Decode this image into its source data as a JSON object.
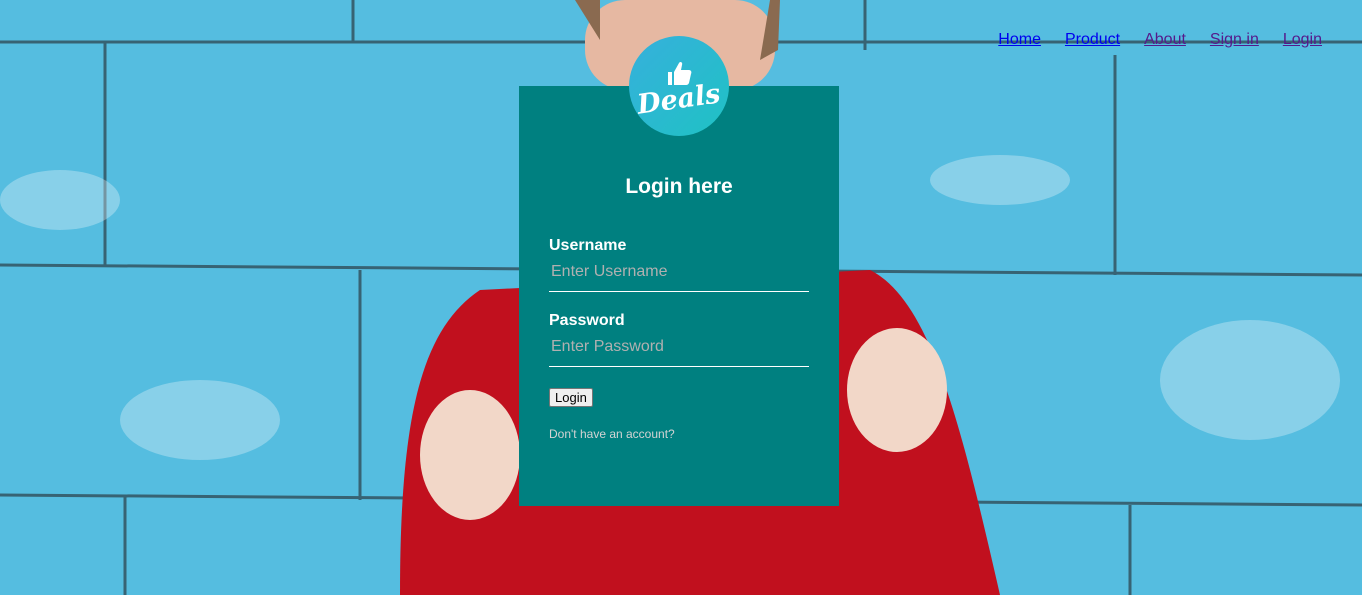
{
  "nav": {
    "items": [
      {
        "label": "Home"
      },
      {
        "label": "Product"
      },
      {
        "label": "About"
      },
      {
        "label": "Sign in"
      },
      {
        "label": "Login"
      }
    ]
  },
  "logo": {
    "text": "Deals",
    "icon": "thumbs-up-icon"
  },
  "form": {
    "title": "Login here",
    "username_label": "Username",
    "username_placeholder": "Enter Username",
    "password_label": "Password",
    "password_placeholder": "Enter Password",
    "submit_label": "Login",
    "signup_link": "Don't have an account?"
  },
  "colors": {
    "card": "#008080",
    "background": "#55bde0",
    "logo_gradient": [
      "#36b0dc",
      "#1fc2c4"
    ],
    "link": "#0000ee",
    "visited_link": "#551a8b"
  }
}
